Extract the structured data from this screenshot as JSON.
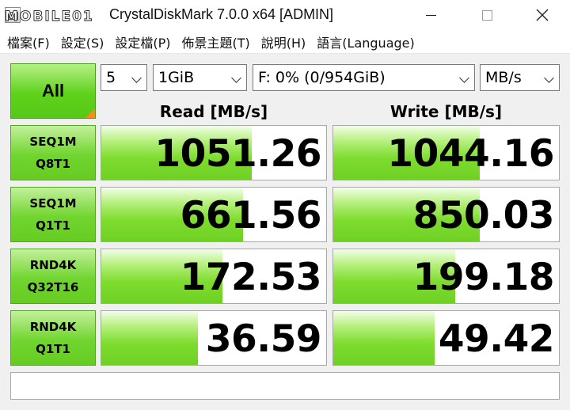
{
  "window": {
    "title": "CrystalDiskMark 7.0.0 x64 [ADMIN]",
    "watermark": "MOBILE01"
  },
  "menu": {
    "items": [
      {
        "label": "檔案(F)"
      },
      {
        "label": "設定(S)"
      },
      {
        "label": "設定檔(P)"
      },
      {
        "label": "佈景主題(T)"
      },
      {
        "label": "說明(H)"
      },
      {
        "label": "語言(Language)"
      }
    ]
  },
  "controls": {
    "all_label": "All",
    "count": "5",
    "size": "1GiB",
    "drive": "F: 0% (0/954GiB)",
    "unit": "MB/s"
  },
  "headers": {
    "read": "Read [MB/s]",
    "write": "Write [MB/s]"
  },
  "tests": [
    {
      "line1": "SEQ1M",
      "line2": "Q8T1",
      "read": "1051.26",
      "write": "1044.16",
      "read_fill": 0.67,
      "write_fill": 0.65
    },
    {
      "line1": "SEQ1M",
      "line2": "Q1T1",
      "read": "661.56",
      "write": "850.03",
      "read_fill": 0.63,
      "write_fill": 0.65
    },
    {
      "line1": "RND4K",
      "line2": "Q32T16",
      "read": "172.53",
      "write": "199.18",
      "read_fill": 0.54,
      "write_fill": 0.54
    },
    {
      "line1": "RND4K",
      "line2": "Q1T1",
      "read": "36.59",
      "write": "49.42",
      "read_fill": 0.43,
      "write_fill": 0.45
    }
  ],
  "comment": ""
}
